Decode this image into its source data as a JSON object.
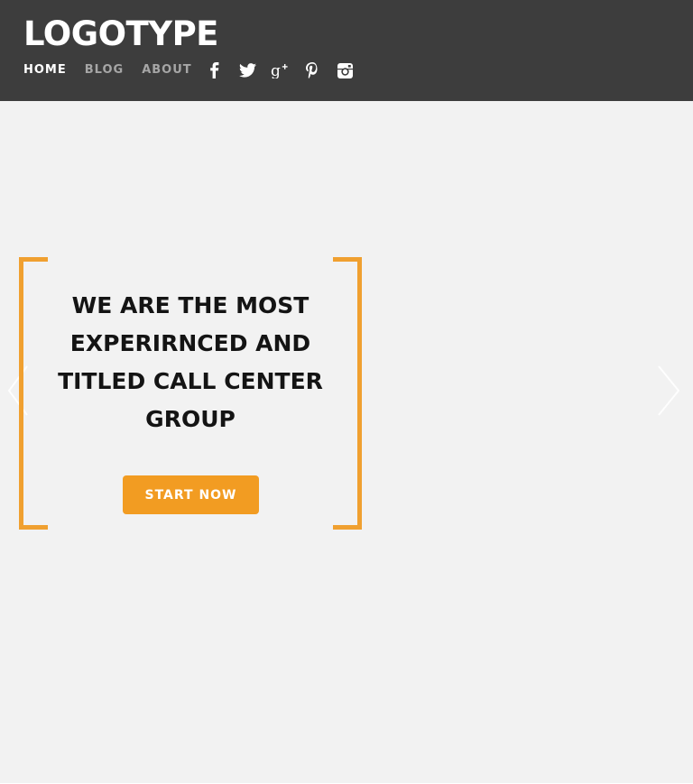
{
  "header": {
    "logo": "LOGOTYPE",
    "nav": [
      {
        "label": "HOME",
        "active": true
      },
      {
        "label": "BLOG",
        "active": false
      },
      {
        "label": "ABOUT",
        "active": false
      }
    ],
    "social": [
      "facebook-icon",
      "twitter-icon",
      "google-plus-icon",
      "pinterest-icon",
      "instagram-icon"
    ]
  },
  "hero": {
    "headline_lines": [
      "WE ARE THE MOST",
      "EXPERIRNCED AND",
      "TITLED CALL CENTER",
      "GROUP"
    ],
    "cta_label": "START NOW"
  },
  "colors": {
    "header_bg": "#3d3d3d",
    "hero_bg": "#f2f2f2",
    "accent": "#f29c22",
    "bracket": "#f0a030",
    "nav_active": "#ffffff",
    "nav_inactive": "#a6a6a6"
  }
}
